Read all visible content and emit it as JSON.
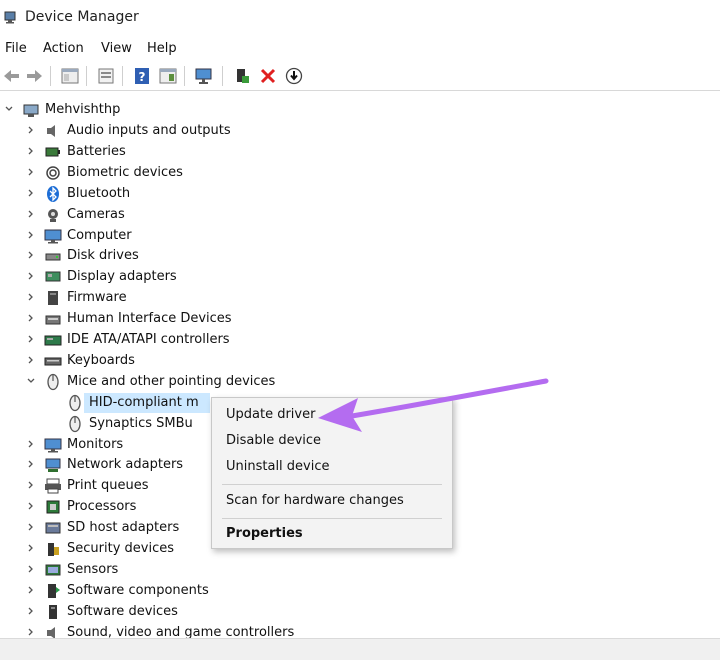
{
  "window": {
    "title": "Device Manager"
  },
  "menu": [
    "File",
    "Action",
    "View",
    "Help"
  ],
  "toolbar": [
    "back-icon",
    "forward-icon",
    "show-hide-tree-icon",
    "properties-icon",
    "help-icon",
    "action-pane-icon",
    "scan-hardware-icon",
    "enable-device-icon",
    "uninstall-icon",
    "update-driver-icon"
  ],
  "tree": {
    "root": "Mehvishthp",
    "items": [
      {
        "label": "Audio inputs and outputs",
        "icon": "speaker-icon"
      },
      {
        "label": "Batteries",
        "icon": "battery-icon"
      },
      {
        "label": "Biometric devices",
        "icon": "fingerprint-icon"
      },
      {
        "label": "Bluetooth",
        "icon": "bluetooth-icon"
      },
      {
        "label": "Cameras",
        "icon": "camera-icon"
      },
      {
        "label": "Computer",
        "icon": "monitor-icon"
      },
      {
        "label": "Disk drives",
        "icon": "disk-drive-icon"
      },
      {
        "label": "Display adapters",
        "icon": "display-adapter-icon"
      },
      {
        "label": "Firmware",
        "icon": "firmware-icon"
      },
      {
        "label": "Human Interface Devices",
        "icon": "hid-icon"
      },
      {
        "label": "IDE ATA/ATAPI controllers",
        "icon": "ide-controller-icon"
      },
      {
        "label": "Keyboards",
        "icon": "keyboard-icon"
      },
      {
        "label": "Mice and other pointing devices",
        "icon": "mouse-icon"
      },
      {
        "label": "HID-compliant m",
        "icon": "mouse-icon"
      },
      {
        "label": "Synaptics SMBu",
        "icon": "mouse-icon"
      },
      {
        "label": "Monitors",
        "icon": "monitor-icon"
      },
      {
        "label": "Network adapters",
        "icon": "network-icon"
      },
      {
        "label": "Print queues",
        "icon": "printer-icon"
      },
      {
        "label": "Processors",
        "icon": "processor-icon"
      },
      {
        "label": "SD host adapters",
        "icon": "sd-card-icon"
      },
      {
        "label": "Security devices",
        "icon": "security-icon"
      },
      {
        "label": "Sensors",
        "icon": "sensor-icon"
      },
      {
        "label": "Software components",
        "icon": "software-component-icon"
      },
      {
        "label": "Software devices",
        "icon": "software-device-icon"
      },
      {
        "label": "Sound, video and game controllers",
        "icon": "speaker-icon"
      }
    ]
  },
  "context_menu": {
    "update": "Update driver",
    "disable": "Disable device",
    "uninstall": "Uninstall device",
    "scan": "Scan for hardware changes",
    "properties": "Properties"
  },
  "colors": {
    "selection": "#cce8ff",
    "arrow": "#b46cf0",
    "uninstall_red": "#e02020"
  }
}
